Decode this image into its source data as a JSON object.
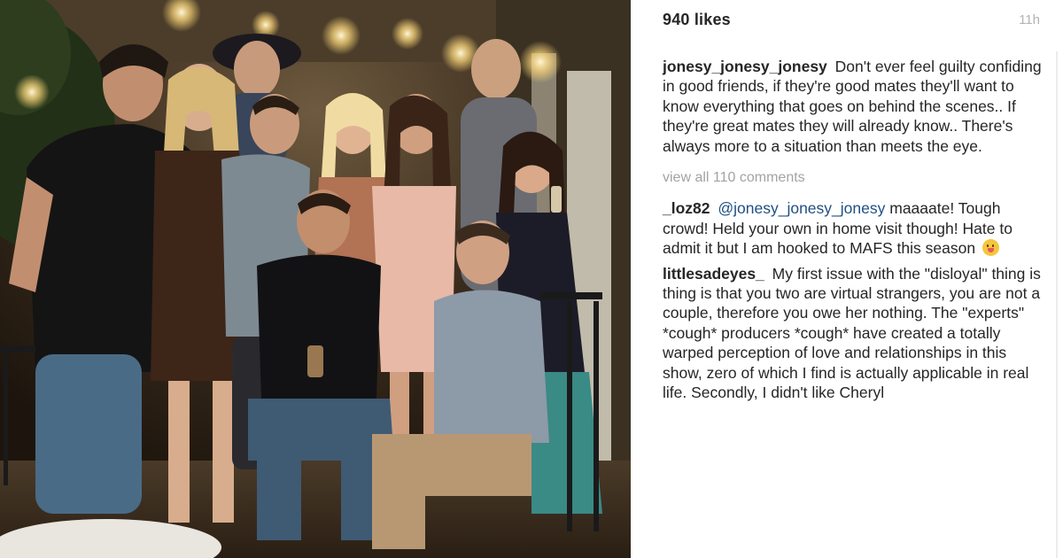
{
  "post": {
    "likes": "940 likes",
    "time_ago": "11h"
  },
  "caption": {
    "username": "jonesy_jonesy_jonesy",
    "text": "Don't ever feel guilty confiding in good friends, if they're good mates they'll want to know everything that goes on behind the scenes.. If they're great mates they will already know.. There's always more to a situation than meets the eye."
  },
  "view_all": "view all 110 comments",
  "comments": [
    {
      "username": "_loz82",
      "mention": "@jonesy_jonesy_jonesy",
      "text": "maaaate! Tough crowd! Held your own in home visit though! Hate to admit it but I am hooked to MAFS this season",
      "emoji": "grinning-tongue-emoji"
    },
    {
      "username": "littlesadeyes_",
      "text": "My first issue with the \"disloyal\" thing is thing is that you two are virtual strangers, you are not a couple, therefore you owe her nothing. The \"experts\" *cough* producers *cough* have created a totally warped perception of love and relationships in this show, zero of which I find is actually applicable in real life. Secondly, I didn't like Cheryl"
    }
  ],
  "photo": {
    "alt_subject": "group-photo-of-friends",
    "colors": {
      "background_dark": "#2b2116",
      "string_light": "#ffe9a8",
      "accent_pink": "#e7b9a6"
    }
  }
}
